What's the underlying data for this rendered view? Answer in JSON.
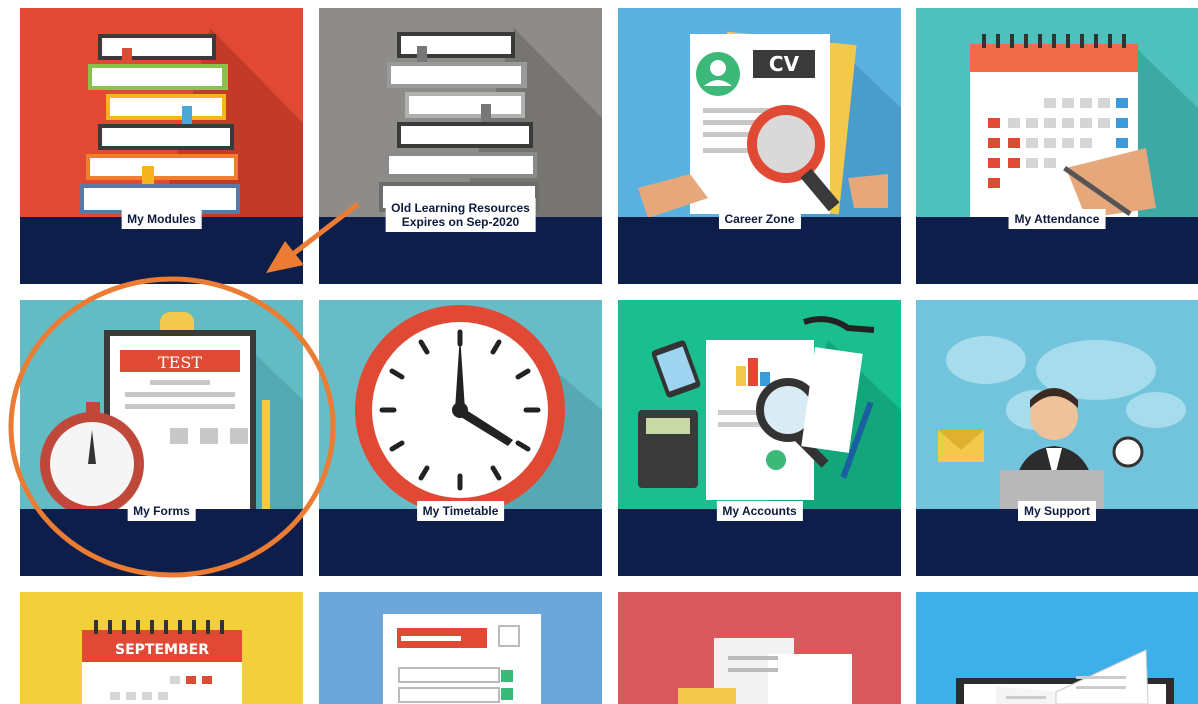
{
  "tiles": [
    {
      "label": "My Modules",
      "color": "#e04a35"
    },
    {
      "label_line1": "Old Learning Resources",
      "label_line2": "Expires on Sep-2020",
      "color": "#8e8c89"
    },
    {
      "label": "Career Zone",
      "color": "#5ab1e0"
    },
    {
      "label": "My Attendance",
      "color": "#4fc1bd"
    },
    {
      "label": "My Forms",
      "color": "#63bcc4"
    },
    {
      "label": "My Timetable",
      "color": "#67bdc7"
    },
    {
      "label": "My Accounts",
      "color": "#1bbf8f"
    },
    {
      "label": "My Support",
      "color": "#72c4dc"
    },
    {
      "color": "#f4cf3c",
      "art_text": "SEPTEMBER"
    },
    {
      "color": "#6da6d9"
    },
    {
      "color": "#d9595c"
    },
    {
      "color": "#3db0ea"
    }
  ],
  "annotation": {
    "color": "#ec7c33"
  },
  "colors": {
    "band": "#0e1e4a"
  }
}
